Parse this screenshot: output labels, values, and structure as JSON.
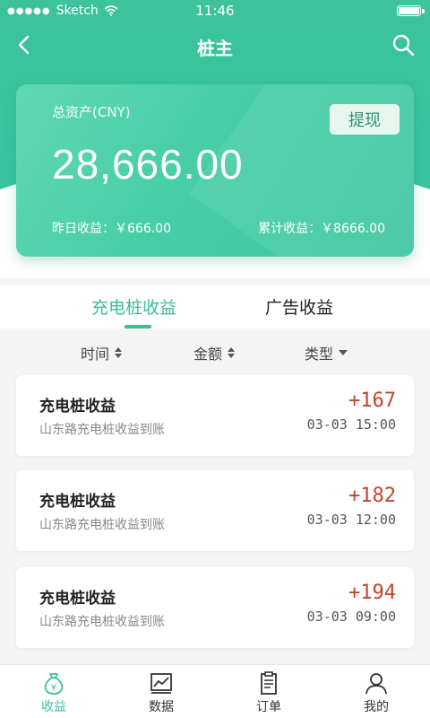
{
  "status_bar": {
    "carrier": "Sketch",
    "time": "11:46"
  },
  "nav": {
    "title": "桩主"
  },
  "asset_card": {
    "label": "总资产(CNY)",
    "withdraw_label": "提现",
    "amount": "28,666.00",
    "yesterday": "昨日收益：￥666.00",
    "total": "累计收益：￥8666.00"
  },
  "tabs": [
    {
      "label": "充电桩收益",
      "active": true
    },
    {
      "label": "广告收益",
      "active": false
    }
  ],
  "filters": {
    "time": "时间",
    "amount": "金额",
    "type": "类型"
  },
  "records": [
    {
      "title": "充电桩收益",
      "desc": "山东路充电桩收益到账",
      "amount": "+167",
      "time": "03-03 15:00"
    },
    {
      "title": "充电桩收益",
      "desc": "山东路充电桩收益到账",
      "amount": "+182",
      "time": "03-03 12:00"
    },
    {
      "title": "充电桩收益",
      "desc": "山东路充电桩收益到账",
      "amount": "+194",
      "time": "03-03 09:00"
    }
  ],
  "tabbar": {
    "items": [
      {
        "label": "收益",
        "icon": "money-bag-icon",
        "active": true
      },
      {
        "label": "数据",
        "icon": "chart-icon",
        "active": false
      },
      {
        "label": "订单",
        "icon": "clipboard-icon",
        "active": false
      },
      {
        "label": "我的",
        "icon": "user-icon",
        "active": false
      }
    ]
  },
  "colors": {
    "accent": "#3cc39c",
    "amount_red": "#c0442a"
  }
}
